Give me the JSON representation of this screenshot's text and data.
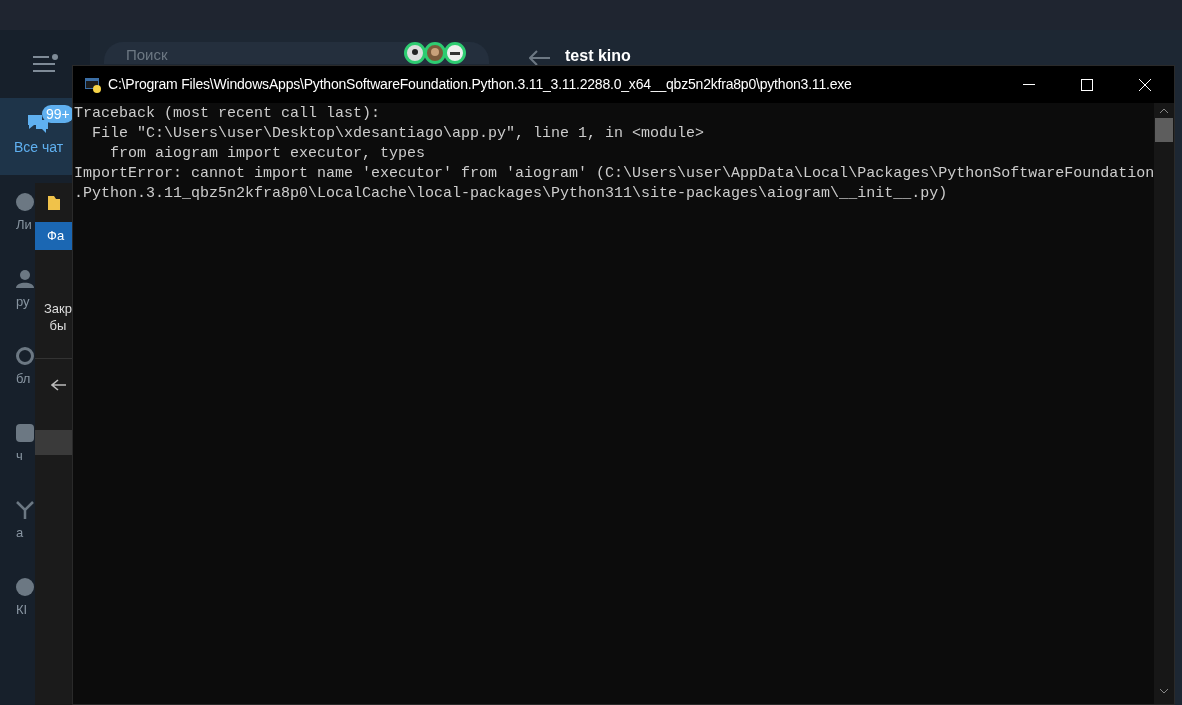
{
  "messenger": {
    "search": {
      "placeholder": "Поиск"
    },
    "chat_title": "test kino",
    "folders": [
      {
        "label": "Все чат",
        "badge": "99+",
        "selected": true
      },
      {
        "label": "Ли",
        "selected": false
      },
      {
        "label": "ру",
        "selected": false
      },
      {
        "label": "бл",
        "selected": false
      },
      {
        "label": "ч",
        "selected": false
      },
      {
        "label": "а",
        "selected": false
      },
      {
        "label": "КІ",
        "selected": false
      }
    ]
  },
  "explorer": {
    "tab": "Фа",
    "message_lines": [
      "Закр",
      "бы"
    ]
  },
  "console": {
    "title": "C:\\Program Files\\WindowsApps\\PythonSoftwareFoundation.Python.3.11_3.11.2288.0_x64__qbz5n2kfra8p0\\python3.11.exe",
    "lines": [
      "Traceback (most recent call last):",
      "  File \"C:\\Users\\user\\Desktop\\xdesantiago\\app.py\", line 1, in <module>",
      "    from aiogram import executor, types",
      "ImportError: cannot import name 'executor' from 'aiogram' (C:\\Users\\user\\AppData\\Local\\Packages\\PythonSoftwareFoundation",
      ".Python.3.11_qbz5n2kfra8p0\\LocalCache\\local-packages\\Python311\\site-packages\\aiogram\\__init__.py)"
    ]
  }
}
